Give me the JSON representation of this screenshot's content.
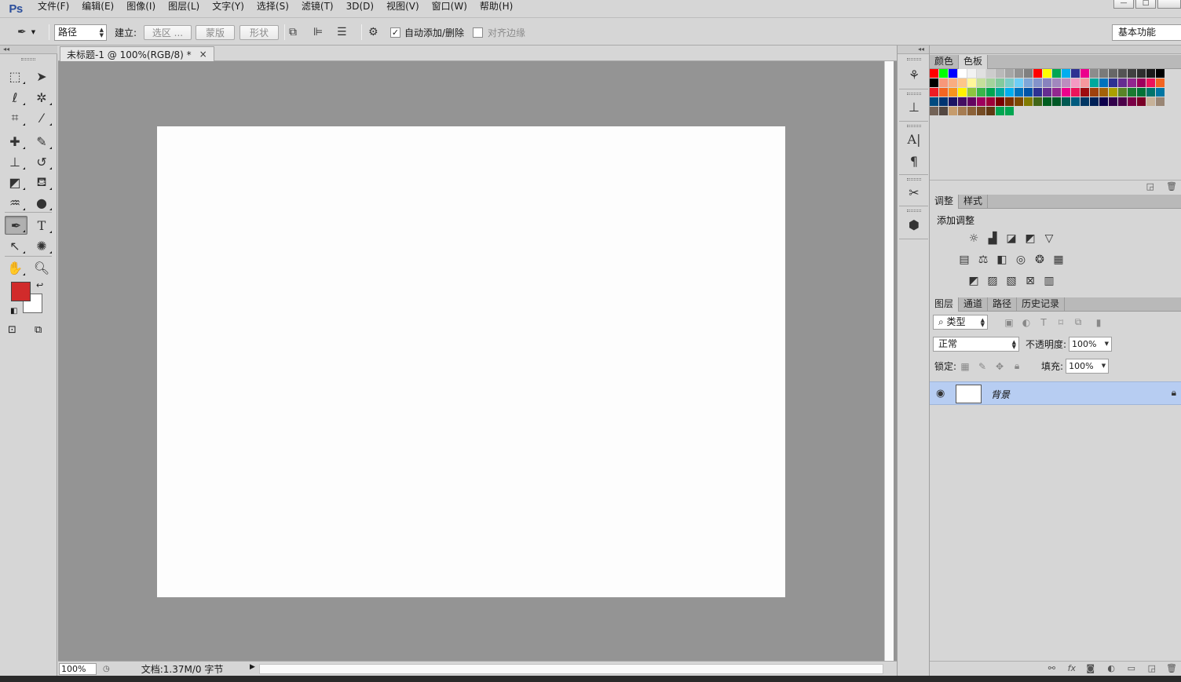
{
  "app": {
    "logo": "Ps"
  },
  "menu": [
    "文件(F)",
    "编辑(E)",
    "图像(I)",
    "图层(L)",
    "文字(Y)",
    "选择(S)",
    "滤镜(T)",
    "3D(D)",
    "视图(V)",
    "窗口(W)",
    "帮助(H)"
  ],
  "window_controls": {
    "minimize": "—",
    "maximize": "□"
  },
  "options": {
    "mode_value": "路径",
    "build_label": "建立:",
    "selection_btn": "选区 ...",
    "mask_btn": "蒙版",
    "shape_btn": "形状",
    "auto_add_delete_label": "自动添加/删除",
    "auto_add_delete_checked": true,
    "align_edges_label": "对齐边缘",
    "align_edges_checked": false,
    "workspace": "基本功能"
  },
  "document": {
    "tab_title": "未标题-1 @ 100%(RGB/8) *",
    "zoom": "100%",
    "doc_info": "文档:1.37M/0 字节",
    "canvas_color": "#fdfdfd",
    "pasteboard_color": "#949494"
  },
  "colors": {
    "foreground": "#d12b2b",
    "background": "#ffffff"
  },
  "panels": {
    "color_tabs": [
      "颜色",
      "色板"
    ],
    "active_color_tab": "色板",
    "adjust_tabs": [
      "调整",
      "样式"
    ],
    "adjust_title": "添加调整",
    "layer_tabs": [
      "图层",
      "通道",
      "路径",
      "历史记录"
    ],
    "filter_kind": "类型",
    "blend_mode": "正常",
    "opacity_label": "不透明度:",
    "opacity_value": "100%",
    "lock_label": "锁定:",
    "fill_label": "填充:",
    "fill_value": "100%",
    "layers": [
      {
        "name": "背景",
        "visible": true,
        "locked": true
      }
    ]
  },
  "swatches": [
    [
      "#ff0000",
      "#00ff00",
      "#0000ff",
      "#ffffff",
      "#f2f2f2",
      "#e0e0e0",
      "#cccccc",
      "#b9b9b9",
      "#a6a6a6",
      "#939393",
      "#808080",
      "#ff0000",
      "#ffff00",
      "#00a651",
      "#00aeef",
      "#2e3192",
      "#ec008c",
      "#8c8c8c",
      "#7a7a7a",
      "#676767",
      "#545454",
      "#414141",
      "#2e2e2e",
      "#1a1a1a",
      "#000000"
    ],
    [
      "#000000",
      "#f7977a",
      "#f9ad81",
      "#fdc68a",
      "#fff79a",
      "#c4df9b",
      "#a3d39c",
      "#82ca9d",
      "#7bcdc8",
      "#6ecff6",
      "#7ea7d8",
      "#8493ca",
      "#8882be",
      "#a187be",
      "#bc8dbf",
      "#f49ac2",
      "#f6989d",
      "#00a99d",
      "#0072bc",
      "#2e3192",
      "#662d91",
      "#92278f",
      "#9e005d",
      "#ed145b",
      "#f26522"
    ],
    [
      "#ed1c24",
      "#f26522",
      "#f7941d",
      "#fff200",
      "#8dc63f",
      "#39b54a",
      "#00a651",
      "#00a99d",
      "#00aeef",
      "#0072bc",
      "#0054a6",
      "#2e3192",
      "#662d91",
      "#92278f",
      "#ec008c",
      "#ed145b",
      "#9e0b0f",
      "#a0410d",
      "#a36209",
      "#aba000",
      "#598527",
      "#1a7b30",
      "#007236",
      "#00746b",
      "#0076a3"
    ],
    [
      "#004b80",
      "#003471",
      "#1b1464",
      "#440e62",
      "#630460",
      "#9e005d",
      "#9e0039",
      "#790000",
      "#7b2e00",
      "#7d4900",
      "#827b00",
      "#406618",
      "#005e20",
      "#005826",
      "#005952",
      "#005b7f",
      "#003663",
      "#002157",
      "#0d004c",
      "#32004b",
      "#4b0049",
      "#7b0046",
      "#7a0026",
      "#c7b299",
      "#998675"
    ],
    [
      "#736357",
      "#534741",
      "#c69c6d",
      "#a67c52",
      "#8c6239",
      "#754c24",
      "#603913",
      "#00a651",
      "#00a651"
    ]
  ]
}
